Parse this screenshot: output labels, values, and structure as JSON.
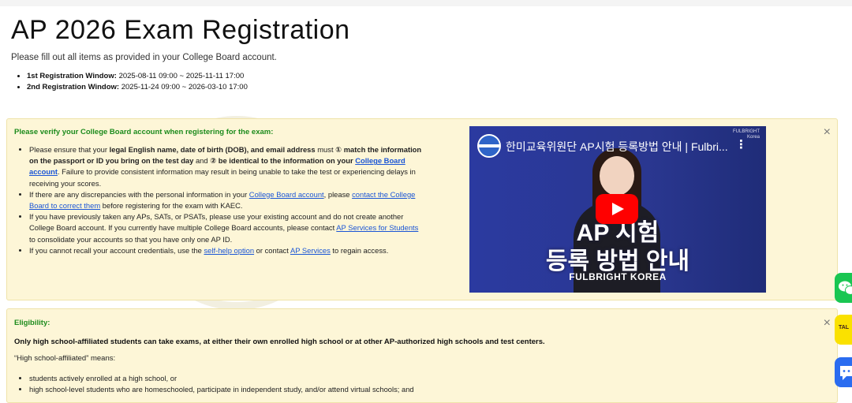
{
  "page": {
    "title": "AP 2026 Exam Registration",
    "subtitle": "Please fill out all items as provided in your College Board account."
  },
  "windows": [
    {
      "label": "1st Registration Window:",
      "value": "2025-08-11 09:00 ~ 2025-11-11 17:00"
    },
    {
      "label": "2nd Registration Window:",
      "value": "2025-11-24 09:00 ~ 2026-03-10 17:00"
    }
  ],
  "notice": {
    "title": "Please verify your College Board account when registering for the exam:",
    "close": "×",
    "item1": {
      "t1": "Please ensure that your ",
      "b1": "legal English name, date of birth (DOB), and email address",
      "t2": " must ",
      "b2": "① match the information on the passport or ID you bring on the test day",
      "t3": " and ",
      "b3": "② be identical to the information on your ",
      "link": "College Board account",
      "t4": ". Failure to provide consistent information may result in being unable to take the test or experiencing delays in receiving your scores."
    },
    "item2": {
      "t1": "If there are any discrepancies with the personal information in your ",
      "link1": "College Board account",
      "t2": ", please ",
      "link2": "contact the College Board to correct them",
      "t3": " before registering for the exam with KAEC."
    },
    "item3": {
      "t1": "If you have previously taken any APs, SATs, or PSATs, please use your existing account and do not create another College Board account. If you currently have multiple College Board accounts, please contact ",
      "link": "AP Services for Students",
      "t2": " to consolidate your accounts so that you have only one AP ID."
    },
    "item4": {
      "t1": "If you cannot recall your account credentials, use the ",
      "link1": "self-help option",
      "t2": " or contact ",
      "link2": "AP Services",
      "t3": " to regain access."
    }
  },
  "video": {
    "title": "한미교육위원단 AP시험 등록방법 안내 | Fulbri...",
    "menu": "⋮",
    "brand_line1": "FULBRIGHT",
    "brand_line2": "Korea",
    "headline1": "AP 시험",
    "headline2": "등록 방법 안내",
    "caption": "FULBRIGHT KOREA"
  },
  "eligibility": {
    "title": "Eligibility:",
    "close": "×",
    "statement": "Only high school-affiliated students can take exams, at either their own enrolled high school or at other AP-authorized high schools and test centers.",
    "means": "“High school-affiliated” means:",
    "items": [
      "students actively enrolled at a high school, or",
      "high school-level students who are homeschooled, participate in independent study, and/or attend virtual schools; and"
    ]
  },
  "floating": {
    "kakao_label": "TAL"
  },
  "colors": {
    "panel_bg": "#fdf6d7",
    "title_green": "#1c8b1c",
    "link_blue": "#1a55d6",
    "video_bg": "#23338c",
    "wechat_green": "#19c652",
    "kakao_yellow": "#fae100",
    "chat_blue": "#2a6cf0"
  }
}
